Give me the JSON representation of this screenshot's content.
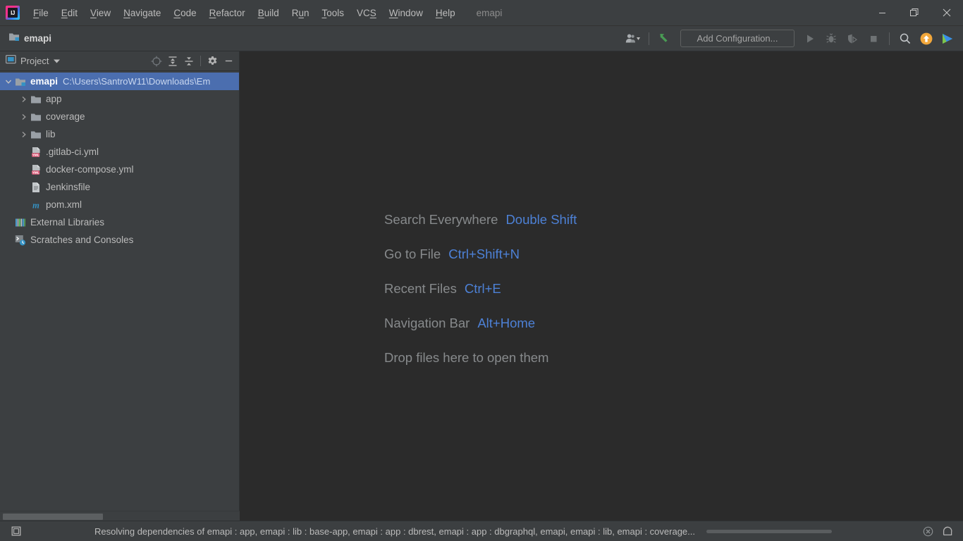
{
  "window": {
    "app_title": "emapi",
    "controls": {
      "minimize": "minimize-window",
      "restore": "restore-window",
      "close": "close-window"
    }
  },
  "menubar": {
    "items": [
      {
        "label": "File",
        "mnemonic": "F"
      },
      {
        "label": "Edit",
        "mnemonic": "E"
      },
      {
        "label": "View",
        "mnemonic": "V"
      },
      {
        "label": "Navigate",
        "mnemonic": "N"
      },
      {
        "label": "Code",
        "mnemonic": "C"
      },
      {
        "label": "Refactor",
        "mnemonic": "R"
      },
      {
        "label": "Build",
        "mnemonic": "B"
      },
      {
        "label": "Run",
        "mnemonic": "u"
      },
      {
        "label": "Tools",
        "mnemonic": "T"
      },
      {
        "label": "VCS",
        "mnemonic": "S"
      },
      {
        "label": "Window",
        "mnemonic": "W"
      },
      {
        "label": "Help",
        "mnemonic": "H"
      }
    ],
    "project_name": "emapi"
  },
  "breadcrumb": {
    "project": "emapi"
  },
  "toolbar": {
    "user_icon": "user-account-icon",
    "vcs_update_icon": "vcs-update-arrow-icon",
    "add_configuration_label": "Add Configuration...",
    "run_icon": "run-play-icon",
    "debug_icon": "debug-bug-icon",
    "coverage_icon": "run-with-coverage-icon",
    "stop_icon": "stop-square-icon",
    "search_icon": "search-icon",
    "update_icon": "ide-update-icon",
    "trainer_icon": "code-with-me-icon"
  },
  "project_panel": {
    "title": "Project",
    "tools": [
      {
        "name": "scroll-from-source-icon",
        "tooltip": "Select Opened File"
      },
      {
        "name": "expand-all-icon",
        "tooltip": "Expand All"
      },
      {
        "name": "collapse-all-icon",
        "tooltip": "Collapse All"
      },
      {
        "name": "settings-gear-icon",
        "tooltip": "Settings"
      },
      {
        "name": "hide-panel-icon",
        "tooltip": "Hide"
      }
    ],
    "tree": [
      {
        "label": "emapi",
        "path": "C:\\Users\\SantroW11\\Downloads\\Em",
        "icon": "module-folder-icon",
        "indent": 0,
        "expanded": true,
        "selected": true,
        "has_arrow": true
      },
      {
        "label": "app",
        "path": "",
        "icon": "folder-icon",
        "indent": 1,
        "expanded": false,
        "selected": false,
        "has_arrow": true
      },
      {
        "label": "coverage",
        "path": "",
        "icon": "folder-icon",
        "indent": 1,
        "expanded": false,
        "selected": false,
        "has_arrow": true
      },
      {
        "label": "lib",
        "path": "",
        "icon": "folder-icon",
        "indent": 1,
        "expanded": false,
        "selected": false,
        "has_arrow": true
      },
      {
        "label": ".gitlab-ci.yml",
        "path": "",
        "icon": "yml-file-icon",
        "indent": 1,
        "expanded": false,
        "selected": false,
        "has_arrow": false
      },
      {
        "label": "docker-compose.yml",
        "path": "",
        "icon": "yml-file-icon",
        "indent": 1,
        "expanded": false,
        "selected": false,
        "has_arrow": false
      },
      {
        "label": "Jenkinsfile",
        "path": "",
        "icon": "text-file-icon",
        "indent": 1,
        "expanded": false,
        "selected": false,
        "has_arrow": false
      },
      {
        "label": "pom.xml",
        "path": "",
        "icon": "maven-file-icon",
        "indent": 1,
        "expanded": false,
        "selected": false,
        "has_arrow": false
      },
      {
        "label": "External Libraries",
        "path": "",
        "icon": "external-libraries-icon",
        "indent": 0,
        "expanded": false,
        "selected": false,
        "has_arrow": false
      },
      {
        "label": "Scratches and Consoles",
        "path": "",
        "icon": "scratches-consoles-icon",
        "indent": 0,
        "expanded": false,
        "selected": false,
        "has_arrow": false
      }
    ]
  },
  "editor": {
    "hints": [
      {
        "label": "Search Everywhere",
        "shortcut": "Double Shift"
      },
      {
        "label": "Go to File",
        "shortcut": "Ctrl+Shift+N"
      },
      {
        "label": "Recent Files",
        "shortcut": "Ctrl+E"
      },
      {
        "label": "Navigation Bar",
        "shortcut": "Alt+Home"
      },
      {
        "label": "Drop files here to open them",
        "shortcut": ""
      }
    ]
  },
  "statusbar": {
    "toggle_icon": "toggle-toolwindows-icon",
    "message": "Resolving dependencies of emapi : app, emapi : lib : base-app, emapi : app : dbrest, emapi : app : dbgraphql, emapi, emapi : lib, emapi : coverage...",
    "progress_percent": 100,
    "cancel_icon": "cancel-process-icon",
    "notifications_icon": "notifications-bell-icon"
  },
  "colors": {
    "accent_blue": "#4b6eaf",
    "hint_key_blue": "#4d81d6",
    "panel_bg": "#3c3f41",
    "editor_bg": "#2b2b2b",
    "text": "#bbbbbb",
    "path_text": "#7a8694",
    "update_orange": "#f2a73b",
    "vcs_green": "#499c54"
  }
}
